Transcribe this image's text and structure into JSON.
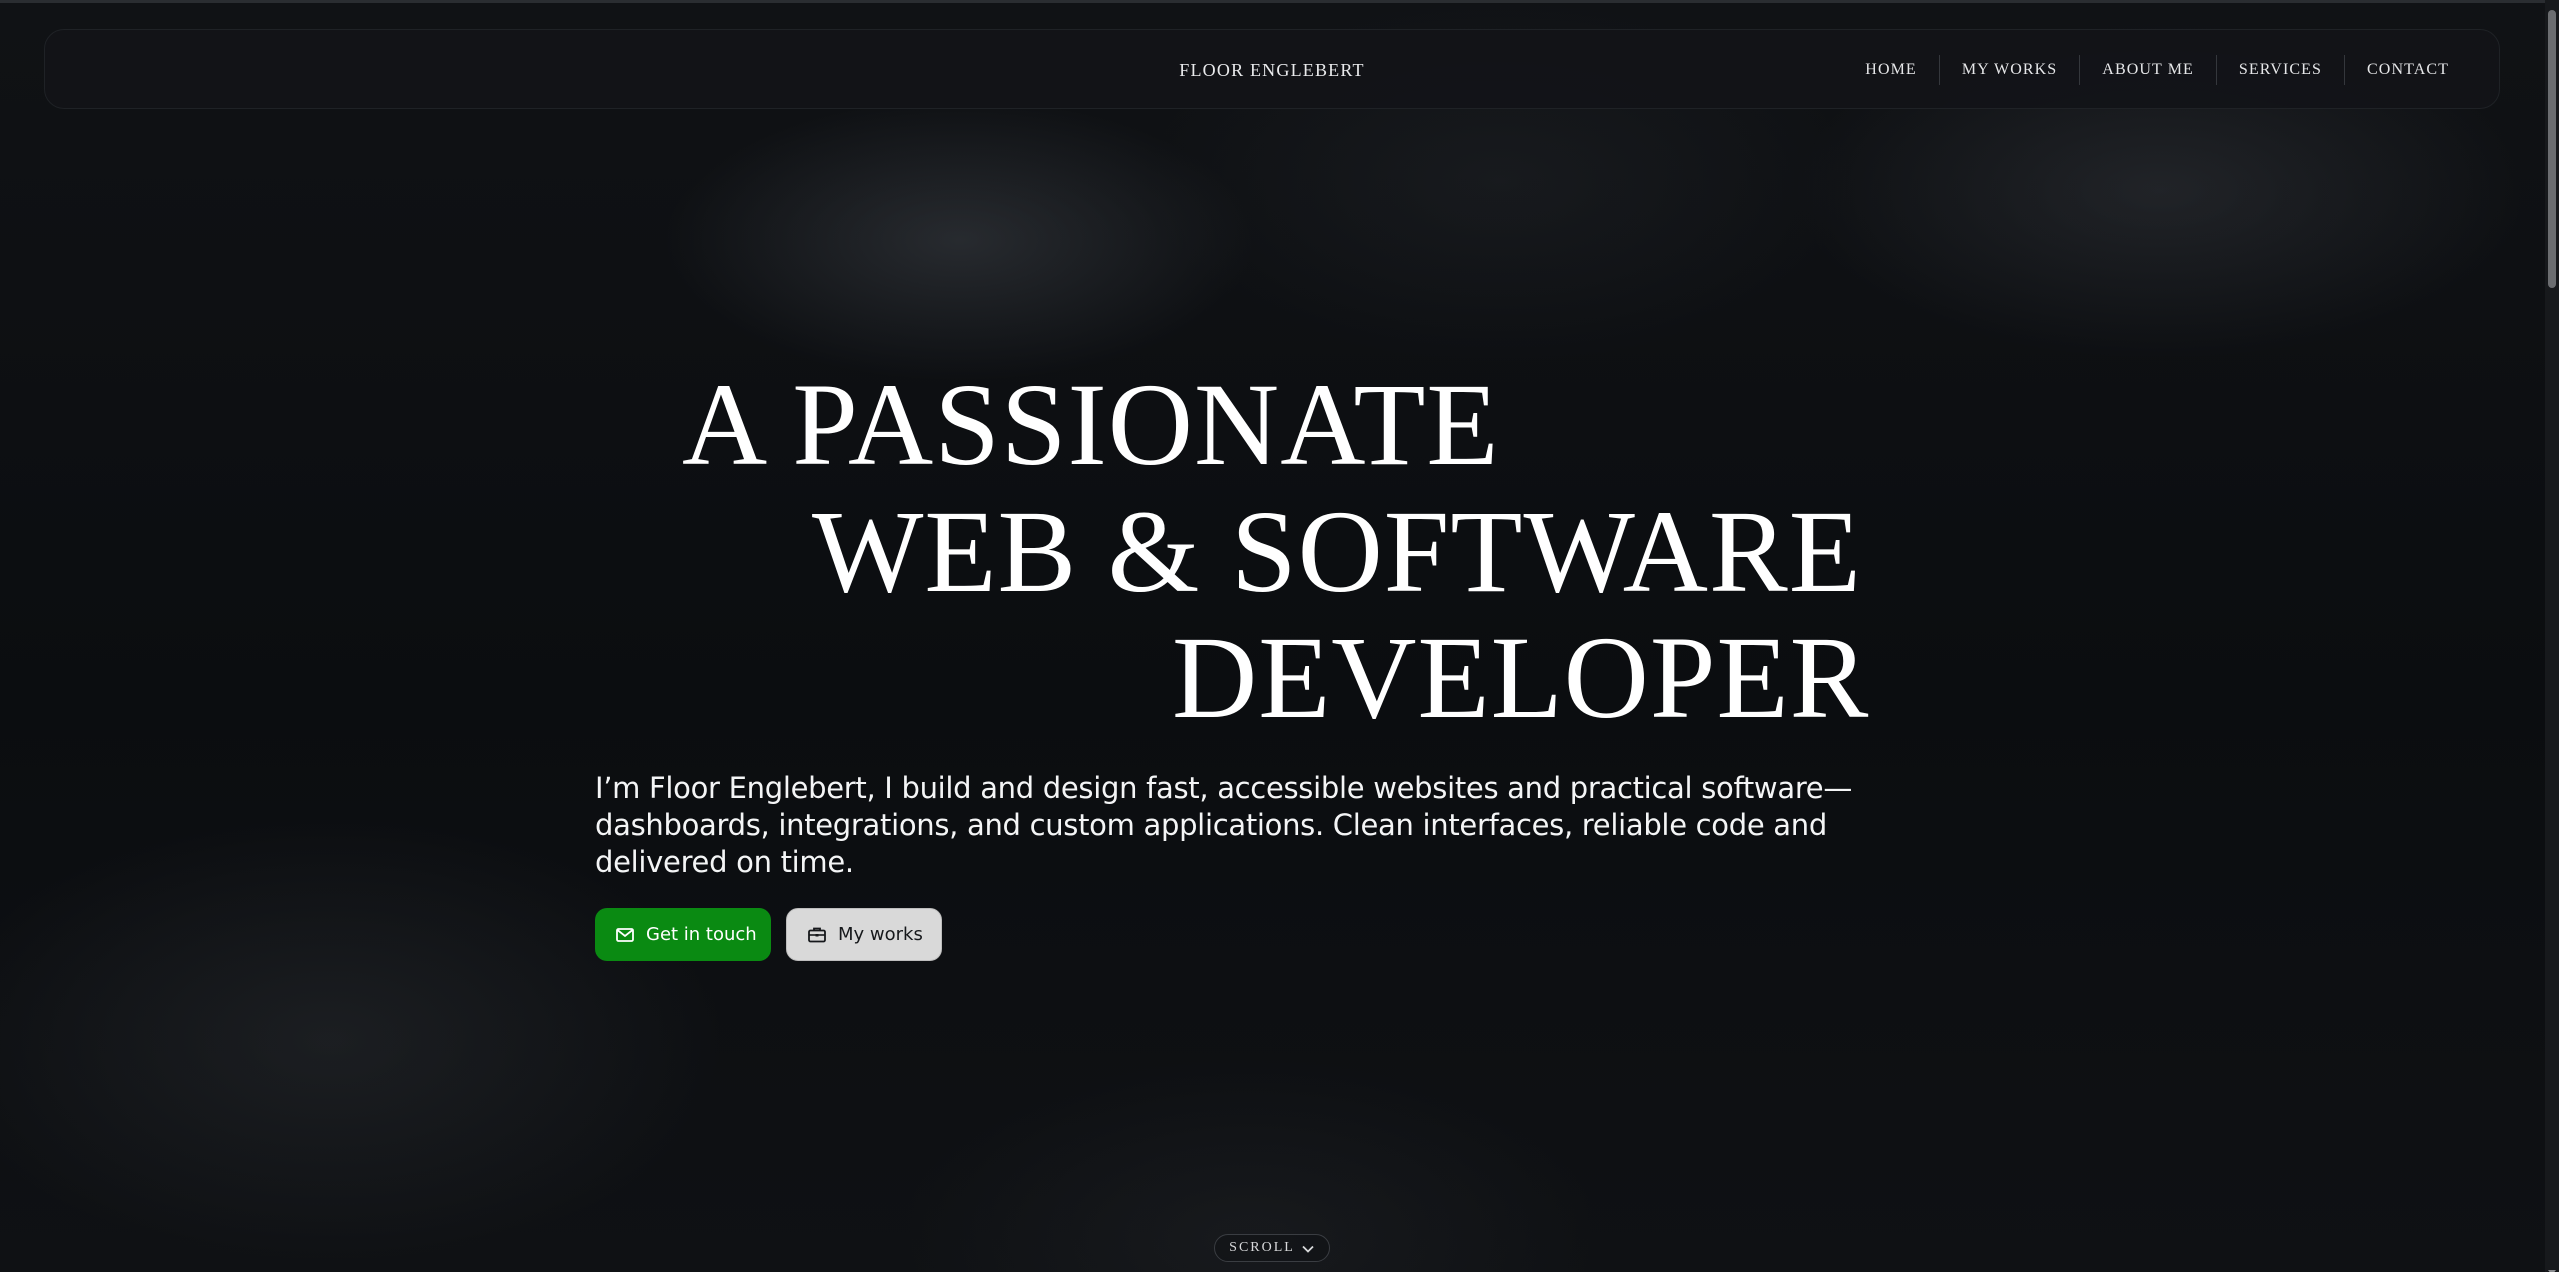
{
  "nav": {
    "brand": "FLOOR ENGLEBERT",
    "links": [
      "HOME",
      "MY WORKS",
      "ABOUT ME",
      "SERVICES",
      "CONTACT"
    ]
  },
  "hero": {
    "line1": "A PASSIONATE",
    "line2": "WEB & SOFTWARE",
    "line3": "DEVELOPER",
    "intro": "I’m Floor Englebert, I build and design fast, accessible websites and practical software—dashboards, integrations, and custom applications. Clean interfaces, reliable code and delivered on time.",
    "primary_button": {
      "label": "Get in touch",
      "icon": "mail-icon"
    },
    "secondary_button": {
      "label": "My works",
      "icon": "briefcase-icon"
    }
  },
  "scroll_hint": {
    "label": "SCROLL",
    "icon": "chevron-down-icon"
  },
  "colors": {
    "background": "#0d0f12",
    "primary_button": "#0a8a12",
    "secondary_button": "#d9d9d9",
    "text": "#ffffff"
  }
}
